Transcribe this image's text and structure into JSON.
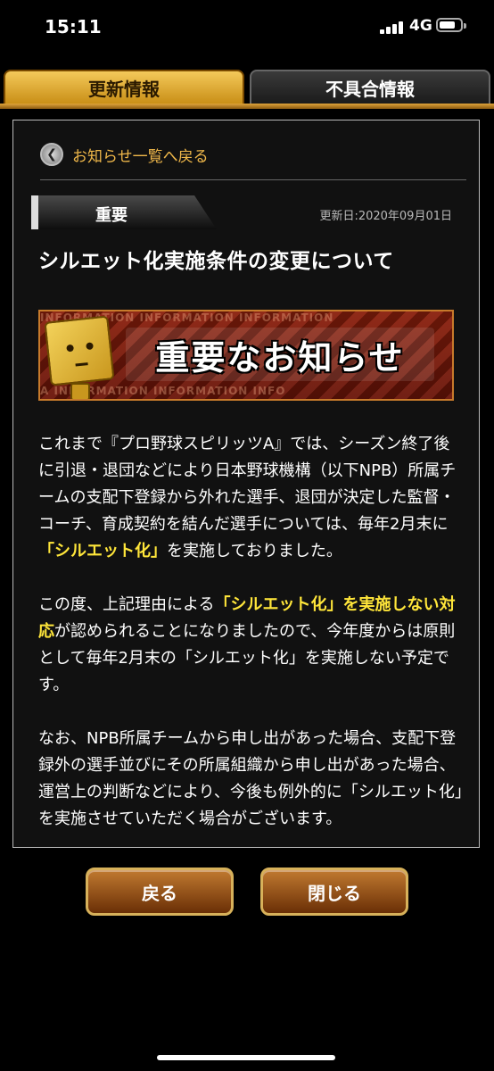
{
  "status_bar": {
    "time": "15:11",
    "network": "4G"
  },
  "tabs": [
    {
      "label": "更新情報",
      "active": true
    },
    {
      "label": "不具合情報",
      "active": false
    }
  ],
  "article": {
    "back_link": "お知らせ一覧へ戻る",
    "badge": "重要",
    "updated": "更新日:2020年09月01日",
    "title": "シルエット化実施条件の変更について",
    "banner": {
      "headline": "重要なお知らせ",
      "strip_top": "INFORMATION INFORMATION INFORMATION",
      "strip_bottom": "A INFORMATION INFORMATION INFO"
    },
    "p1_a": "これまで『プロ野球スピリッツA』では、シーズン終了後に引退・退団などにより日本野球機構（以下NPB）所属チームの支配下登録から外れた選手、退団が決定した監督・コーチ、育成契約を結んだ選手については、毎年2月末に",
    "p1_hl": "「シルエット化」",
    "p1_b": "を実施しておりました。",
    "p2_a": "この度、上記理由による",
    "p2_hl": "「シルエット化」を実施しない対応",
    "p2_b": "が認められることになりましたので、今年度からは原則として毎年2月末の「シルエット化」を実施しない予定です。",
    "p3": "なお、NPB所属チームから申し出があった場合、支配下登録外の選手並びにその所属組織から申し出があった場合、運営上の判断などにより、今後も例外的に「シルエット化」を実施させていただく場合がございます。"
  },
  "buttons": {
    "back": "戻る",
    "close": "閉じる"
  }
}
